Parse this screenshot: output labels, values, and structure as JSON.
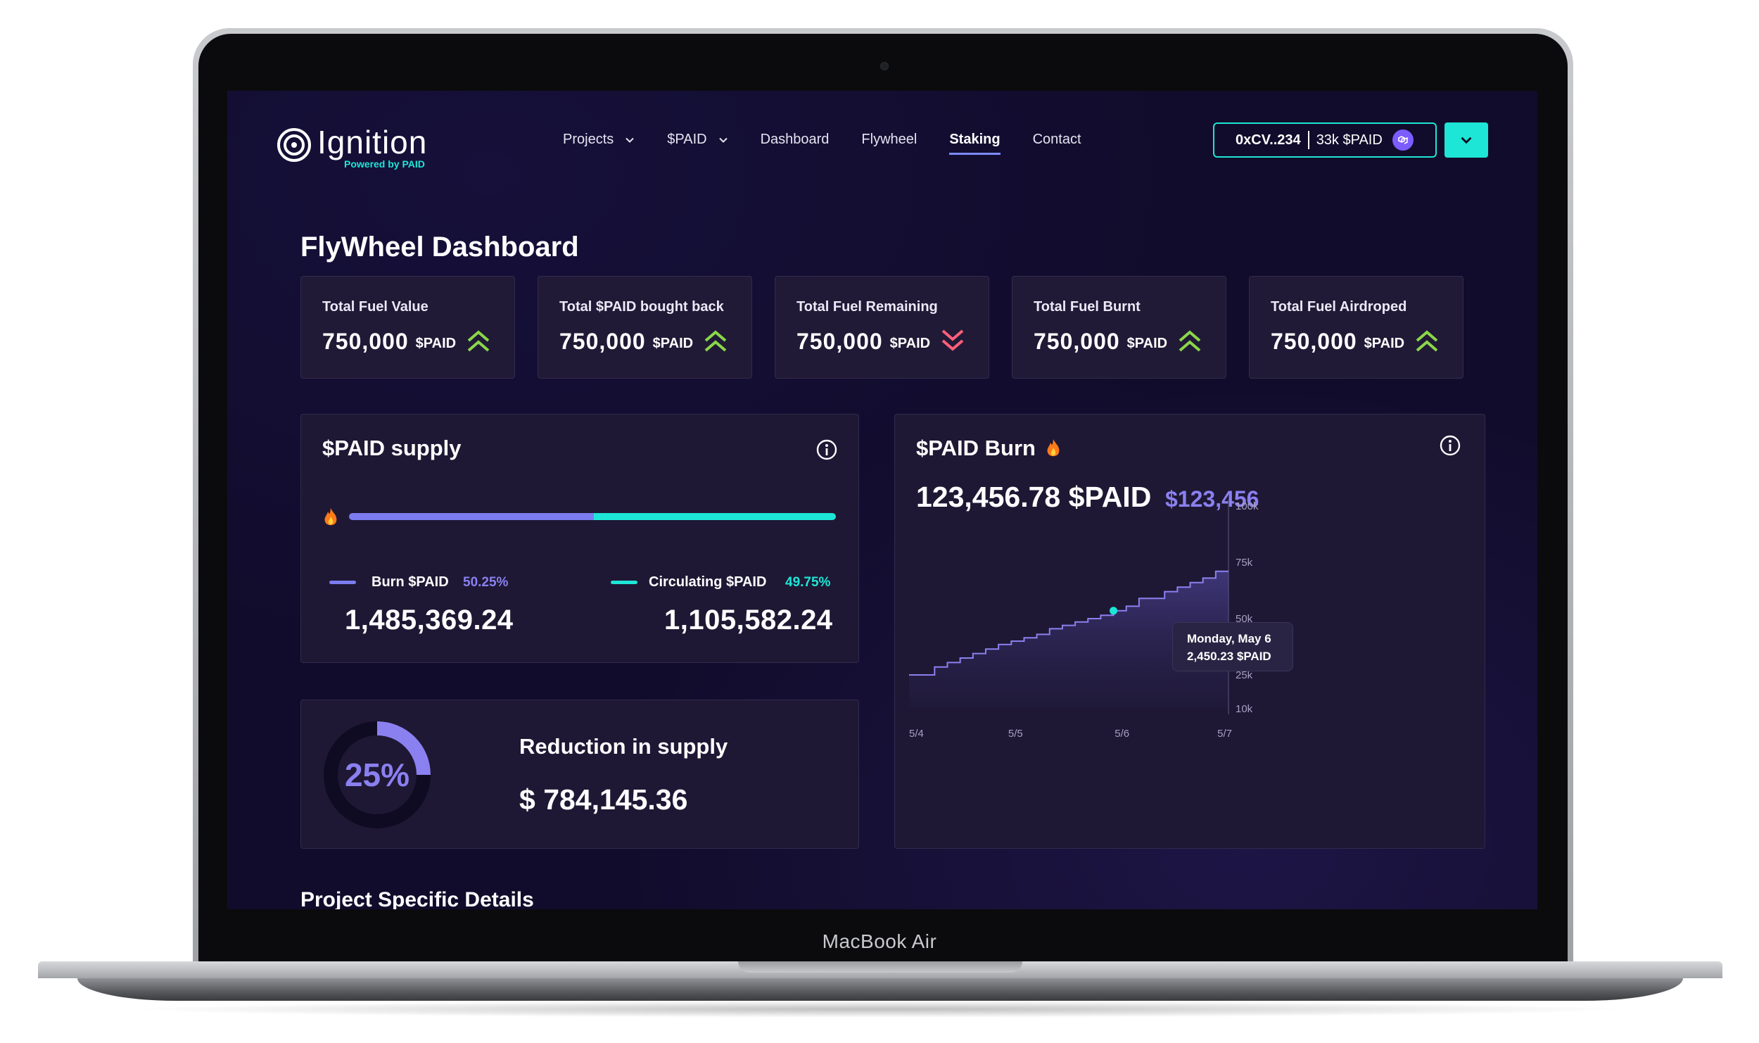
{
  "device": {
    "label": "MacBook Air"
  },
  "brand": {
    "name": "Ignition",
    "tagline": "Powered by PAID",
    "accent": "#1de6d6"
  },
  "nav": {
    "items": [
      {
        "label": "Projects",
        "dropdown": true,
        "active": false
      },
      {
        "label": "$PAID",
        "dropdown": true,
        "active": false
      },
      {
        "label": "Dashboard",
        "dropdown": false,
        "active": false
      },
      {
        "label": "Flywheel",
        "dropdown": false,
        "active": false
      },
      {
        "label": "Staking",
        "dropdown": false,
        "active": true
      },
      {
        "label": "Contact",
        "dropdown": false,
        "active": false
      }
    ],
    "wallet": {
      "address": "0xCV..234",
      "balance": "33k $PAID",
      "icon": "polygon-coin-icon"
    },
    "dropdown_icon": "chevron-down-icon"
  },
  "page": {
    "title": "FlyWheel Dashboard"
  },
  "stats": [
    {
      "label": "Total Fuel Value",
      "value": "750,000",
      "unit": "$PAID",
      "trend": "up"
    },
    {
      "label": "Total $PAID bought back",
      "value": "750,000",
      "unit": "$PAID",
      "trend": "up"
    },
    {
      "label": "Total Fuel Remaining",
      "value": "750,000",
      "unit": "$PAID",
      "trend": "down"
    },
    {
      "label": "Total Fuel Burnt",
      "value": "750,000",
      "unit": "$PAID",
      "trend": "up"
    },
    {
      "label": "Total Fuel Airdroped",
      "value": "750,000",
      "unit": "$PAID",
      "trend": "up"
    }
  ],
  "colors": {
    "up": "#8bd64a",
    "down": "#ff5f7a",
    "burn": "#7c7cf0",
    "circulating": "#1de6d6"
  },
  "supply": {
    "title": "$PAID supply",
    "burn": {
      "label": "Burn $PAID",
      "percent": "50.25%",
      "share": 0.5025,
      "amount": "1,485,369.24"
    },
    "circulating": {
      "label": "Circulating $PAID",
      "percent": "49.75%",
      "share": 0.4975,
      "amount": "1,105,582.24"
    }
  },
  "reduction": {
    "title": "Reduction in supply",
    "percent_label": "25%",
    "fraction": 0.25,
    "amount": "$ 784,145.36"
  },
  "burn": {
    "title": "$PAID Burn",
    "amount": "123,456.78 $PAID",
    "usd": "$123,456",
    "tooltip": {
      "date": "Monday, May 6",
      "value": "2,450.23 $PAID"
    }
  },
  "chart_data": {
    "type": "area",
    "step": true,
    "x_ticks": [
      "5/4",
      "5/5",
      "5/6",
      "5/7"
    ],
    "y_ticks": [
      "100k",
      "75k",
      "50k",
      "25k",
      "10k"
    ],
    "y_tick_values": [
      100000,
      75000,
      50000,
      25000,
      10000
    ],
    "ylim": [
      10000,
      100000
    ],
    "xlim": [
      0,
      3
    ],
    "x": [
      0,
      0.24,
      0.36,
      0.48,
      0.6,
      0.72,
      0.84,
      0.96,
      1.08,
      1.2,
      1.32,
      1.44,
      1.56,
      1.68,
      1.8,
      1.92,
      2.04,
      2.16,
      2.28,
      2.4,
      2.52,
      2.64,
      2.76,
      2.88,
      3.0
    ],
    "values": [
      25000,
      28500,
      30500,
      32500,
      34500,
      36500,
      38500,
      40000,
      41500,
      43000,
      45500,
      47000,
      48500,
      50000,
      51500,
      53500,
      55500,
      59000,
      59000,
      62000,
      64000,
      66000,
      68000,
      71000,
      71000
    ],
    "highlight": {
      "x": 1.92,
      "value": 53500
    },
    "line_color": "#8b80f0",
    "highlight_color": "#1de6d6"
  },
  "section": {
    "title": "Project Specific Details"
  }
}
